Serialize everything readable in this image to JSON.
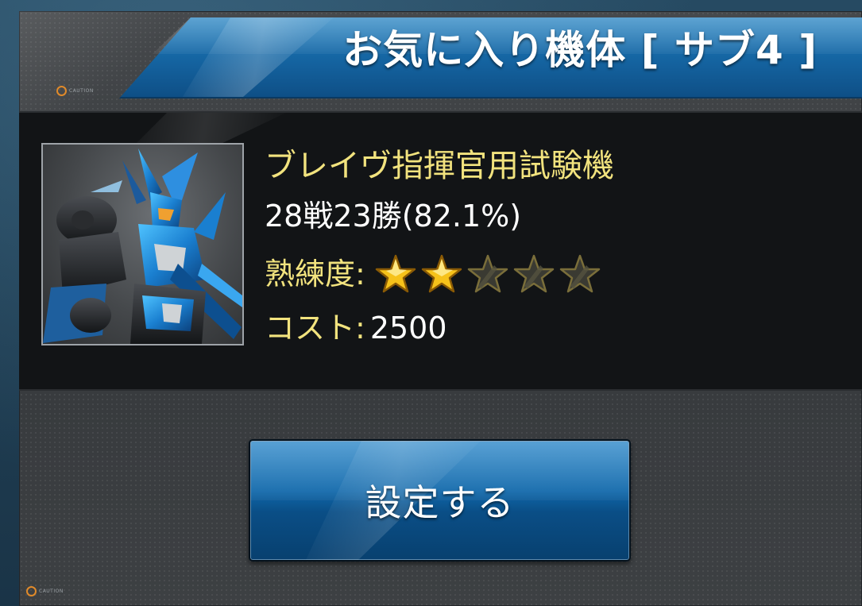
{
  "header": {
    "title": "お気に入り機体 [ サブ4 ]"
  },
  "markers": {
    "top_label": "CAUTION",
    "bottom_label": "CAUTION"
  },
  "unit": {
    "name": "ブレイヴ指揮官用試験機",
    "record": "28戦23勝(82.1%)",
    "proficiency_label": "熟練度:",
    "proficiency_stars": {
      "filled": 2,
      "total": 5
    },
    "cost_label": "コスト:",
    "cost_value": "2500",
    "portrait_icon": "blue-mecha-portrait"
  },
  "actions": {
    "set_label": "設定する"
  },
  "colors": {
    "accent_blue": "#1668a6",
    "gold_text": "#f2e37e",
    "star_gold": "#f6c21a",
    "star_empty": "#3a3a32"
  }
}
